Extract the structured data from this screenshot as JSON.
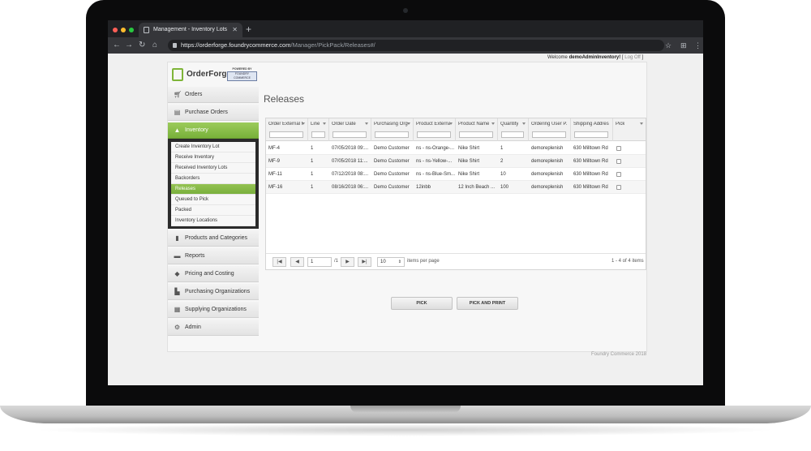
{
  "browser": {
    "tab_title": "Management - Inventory Lots",
    "new_tab": "+",
    "url_host": "https://orderforge.foundrycommerce.com",
    "url_path": "/Manager/PickPack/Releases#/"
  },
  "header": {
    "welcome_prefix": "Welcome ",
    "user": "demoAdminInventory!",
    "separator": " [",
    "logoff": "Log Off",
    "close_bracket": "]"
  },
  "logo": {
    "text": "OrderForge",
    "powered_by": "POWERED BY",
    "partner": "FOUNDRY COMMERCE"
  },
  "sidebar": {
    "items": [
      {
        "label": "Orders",
        "icon": "cart-icon"
      },
      {
        "label": "Purchase Orders",
        "icon": "clipboard-icon"
      },
      {
        "label": "Inventory",
        "icon": "flask-icon"
      },
      {
        "label": "Products and Categories",
        "icon": "book-icon"
      },
      {
        "label": "Reports",
        "icon": "report-icon"
      },
      {
        "label": "Pricing and Costing",
        "icon": "tag-icon"
      },
      {
        "label": "Purchasing Organizations",
        "icon": "buildings-icon"
      },
      {
        "label": "Supplying Organizations",
        "icon": "boxes-icon"
      },
      {
        "label": "Admin",
        "icon": "gear-icon"
      }
    ],
    "submenu": [
      "Create Inventory Lot",
      "Receive Inventory",
      "Received Inventory Lots",
      "Backorders",
      "Releases",
      "Queued to Pick",
      "Packed",
      "Inventory Locations"
    ]
  },
  "main": {
    "title": "Releases",
    "columns": [
      "Order External N...",
      "Line",
      "Order Date",
      "Purchasing Org...",
      "Product External...",
      "Product Name",
      "Quantity",
      "Ordering User P...",
      "Shipping Address...",
      "Pick"
    ],
    "rows": [
      [
        "MF-4",
        "1",
        "07/05/2018 09:...",
        "Demo Customer",
        "ns - ns-Orange-...",
        "Nike Shirt",
        "1",
        "demoreplenish",
        "630 Milltown Rd"
      ],
      [
        "MF-9",
        "1",
        "07/05/2018 11:...",
        "Demo Customer",
        "ns - ns-Yellow-...",
        "Nike Shirt",
        "2",
        "demoreplenish",
        "630 Milltown Rd"
      ],
      [
        "MF-11",
        "1",
        "07/12/2018 08:...",
        "Demo Customer",
        "ns - ns-Blue-Sm...",
        "Nike Shirt",
        "10",
        "demoreplenish",
        "630 Milltown Rd"
      ],
      [
        "MF-16",
        "1",
        "08/16/2018 06:...",
        "Demo Customer",
        "12inbb",
        "12 Inch Beach ...",
        "100",
        "demoreplenish",
        "630 Milltown Rd"
      ]
    ],
    "pager": {
      "page": "1",
      "of_prefix": "/",
      "total_pages": "1",
      "page_size": "10",
      "items_per_page": "items per page",
      "summary": "1 - 4 of 4 items"
    },
    "buttons": {
      "pick": "PICK",
      "pick_print": "PICK AND PRINT"
    }
  },
  "footer": {
    "text": "Foundry Commerce 2018"
  }
}
